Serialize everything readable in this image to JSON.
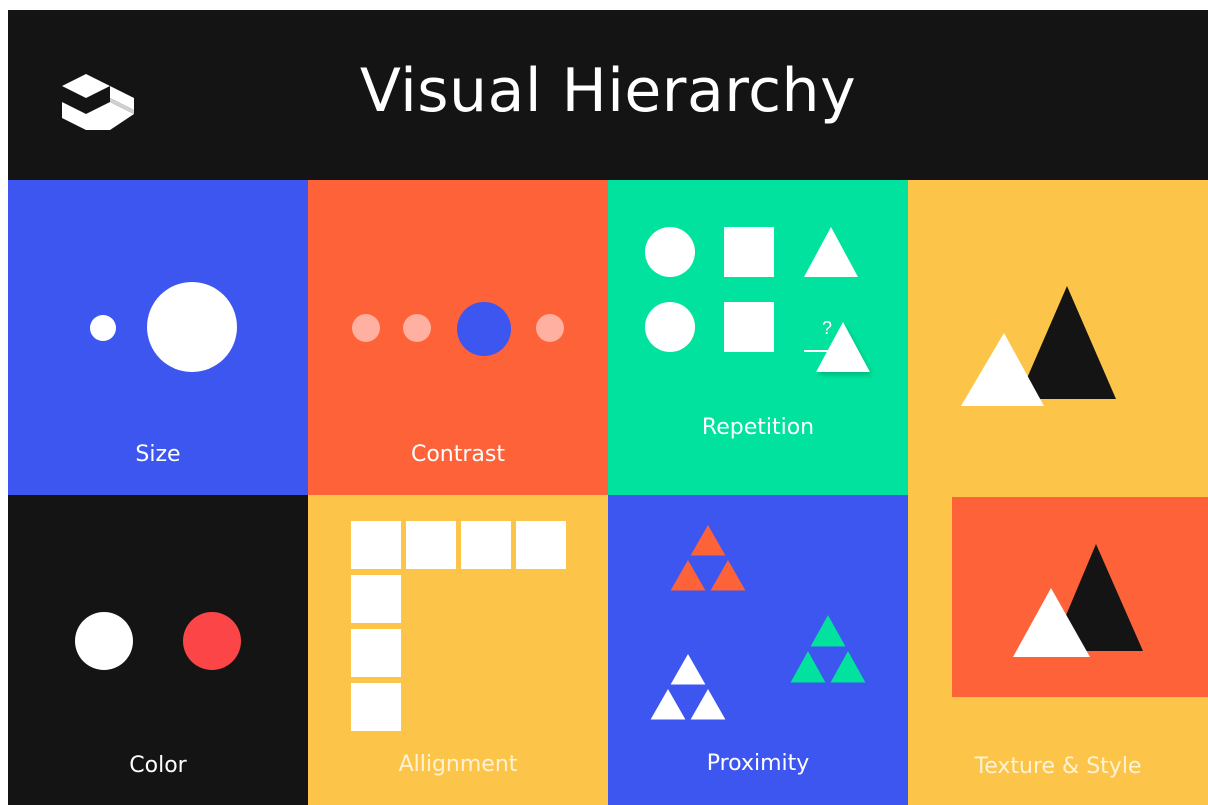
{
  "title": "Visual Hierarchy",
  "colors": {
    "black": "#141414",
    "blue": "#3d56f0",
    "orange": "#fd6239",
    "green": "#00e29d",
    "yellow": "#fcc54a",
    "red": "#fb4546",
    "white": "#ffffff"
  },
  "icons": {
    "logo": "isometric-box-logo-icon"
  },
  "panels": {
    "size": {
      "label": "Size"
    },
    "contrast": {
      "label": "Contrast"
    },
    "repetition": {
      "label": "Repetition",
      "question_mark": "?"
    },
    "color": {
      "label": "Color"
    },
    "alignment": {
      "label": "Allignment"
    },
    "proximity": {
      "label": "Proximity"
    },
    "texture_style": {
      "label": "Texture & Style"
    }
  }
}
